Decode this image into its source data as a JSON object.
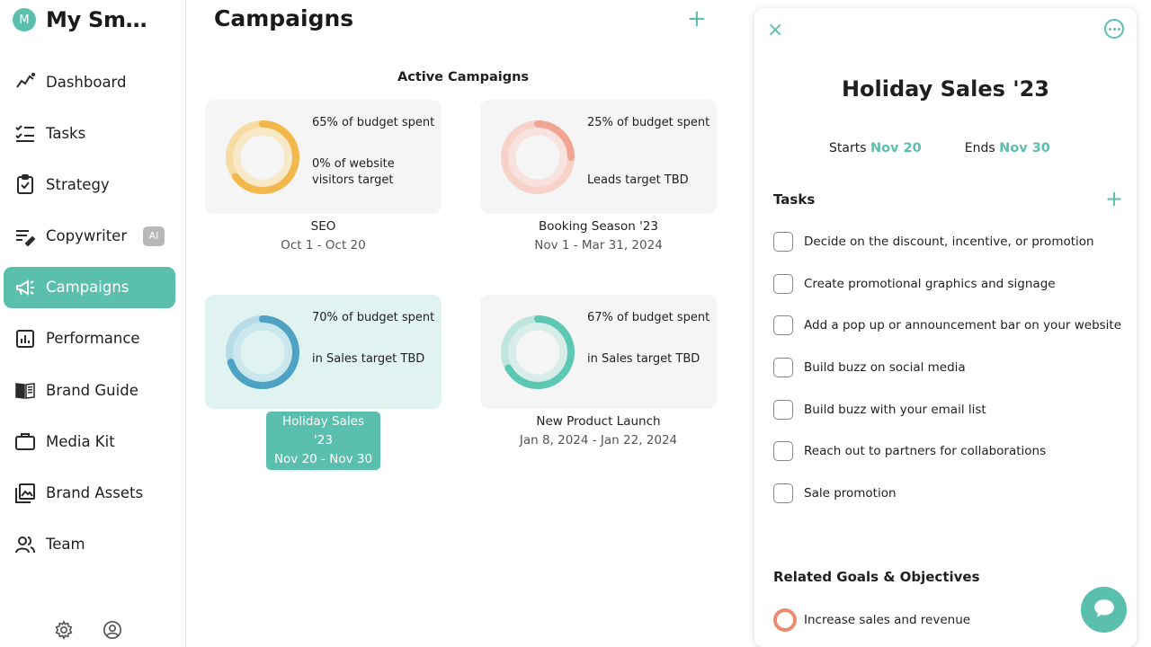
{
  "app": {
    "avatar_letter": "M",
    "name": "My Sm…"
  },
  "sidebar": {
    "items": [
      {
        "label": "Dashboard",
        "icon": "trend-icon"
      },
      {
        "label": "Tasks",
        "icon": "checklist-icon"
      },
      {
        "label": "Strategy",
        "icon": "clipboard-check-icon"
      },
      {
        "label": "Copywriter",
        "icon": "edit-lines-icon",
        "badge": "AI"
      },
      {
        "label": "Campaigns",
        "icon": "megaphone-icon",
        "active": true
      },
      {
        "label": "Performance",
        "icon": "bar-chart-icon"
      },
      {
        "label": "Brand Guide",
        "icon": "book-icon"
      },
      {
        "label": "Media Kit",
        "icon": "briefcase-icon"
      },
      {
        "label": "Brand Assets",
        "icon": "image-icon"
      },
      {
        "label": "Team",
        "icon": "people-icon"
      }
    ],
    "footer": [
      "gear-icon",
      "user-circle-icon"
    ]
  },
  "main": {
    "title": "Campaigns",
    "add_label": "+",
    "section_title": "Active Campaigns",
    "campaigns": [
      {
        "name": "SEO",
        "dates": "Oct 1 - Oct 20",
        "stat1": "65% of budget spent",
        "stat2": "0% of website visitors target",
        "budget_fraction": 0.65,
        "color": "#f2b84b",
        "track": "#f7dca3"
      },
      {
        "name": "Booking Season '23",
        "dates": "Nov 1 - Mar 31, 2024",
        "stat1": "25% of budget spent",
        "stat2": "Leads target TBD",
        "budget_fraction": 0.25,
        "color": "#f0a593",
        "track": "#f7d2c8"
      },
      {
        "name": "Holiday Sales '23",
        "dates": "Nov 20 - Nov 30",
        "stat1": "70% of budget spent",
        "stat2": "in Sales target TBD",
        "budget_fraction": 0.7,
        "color": "#4ea2c3",
        "track": "#b7dce8",
        "selected": true
      },
      {
        "name": "New Product Launch",
        "dates": "Jan 8, 2024 - Jan 22, 2024",
        "stat1": "67% of budget spent",
        "stat2": "in Sales target TBD",
        "budget_fraction": 0.67,
        "color": "#5cc7b2",
        "track": "#bfe6de"
      }
    ]
  },
  "panel": {
    "close_label": "×",
    "title": "Holiday Sales '23",
    "starts_label": "Starts",
    "starts_value": "Nov 20",
    "ends_label": "Ends",
    "ends_value": "Nov 30",
    "tasks_heading": "Tasks",
    "tasks_add": "+",
    "tasks": [
      "Decide on the discount, incentive, or promotion",
      "Create promotional graphics and signage",
      "Add a pop up or announcement bar on your website",
      "Build buzz on social media",
      "Build buzz with your email list",
      "Reach out to partners for collaborations",
      "Sale promotion"
    ],
    "goals_heading": "Related Goals & Objectives",
    "goals": [
      "Increase sales and revenue"
    ]
  },
  "colors": {
    "accent": "#5bbfae",
    "goal_ring": "#ea8b6f"
  }
}
